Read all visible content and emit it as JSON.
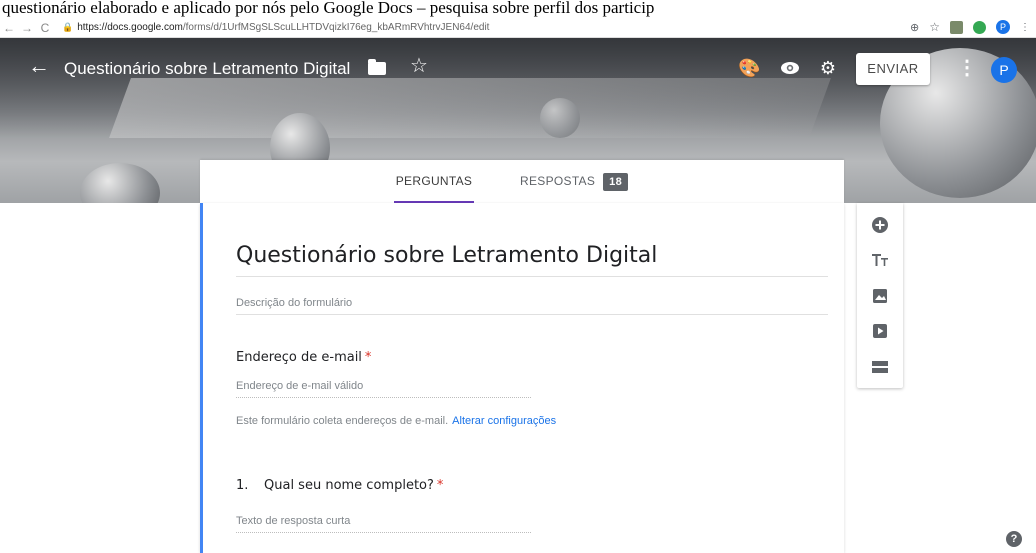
{
  "caption": {
    "text": "questionário elaborado e aplicado por nós pelo Google Docs – pesquisa sobre perfil dos particip"
  },
  "browser": {
    "url_host": "https://docs.google.com",
    "url_path": "/forms/d/1UrfMSgSLScuLLHTDVqizkI76eg_kbARmRVhtrvJEN64/edit",
    "avatar_letter": "P"
  },
  "header": {
    "title": "Questionário sobre Letramento Digital",
    "send_label": "ENVIAR",
    "avatar_letter": "P"
  },
  "tabs": {
    "questions_label": "PERGUNTAS",
    "responses_label": "RESPOSTAS",
    "responses_count": "18"
  },
  "form": {
    "title": "Questionário sobre Letramento Digital",
    "description_placeholder": "Descrição do formulário",
    "email_label": "Endereço de e-mail",
    "email_required_mark": "*",
    "email_placeholder": "Endereço de e-mail válido",
    "collect_note": "Este formulário coleta endereços de e-mail.",
    "change_settings_link": "Alterar configurações",
    "question1_number": "1.",
    "question1_label": "Qual seu nome completo?",
    "question1_required_mark": "*",
    "question1_placeholder": "Texto de resposta curta"
  },
  "toolbar": {
    "items": [
      "add-question-icon",
      "add-title-icon",
      "add-image-icon",
      "add-video-icon",
      "add-section-icon"
    ]
  },
  "help": {
    "label": "?"
  },
  "colors": {
    "accent": "#4285f4",
    "tab_underline": "#673ab7",
    "link": "#1a73e8",
    "required": "#d93025"
  }
}
